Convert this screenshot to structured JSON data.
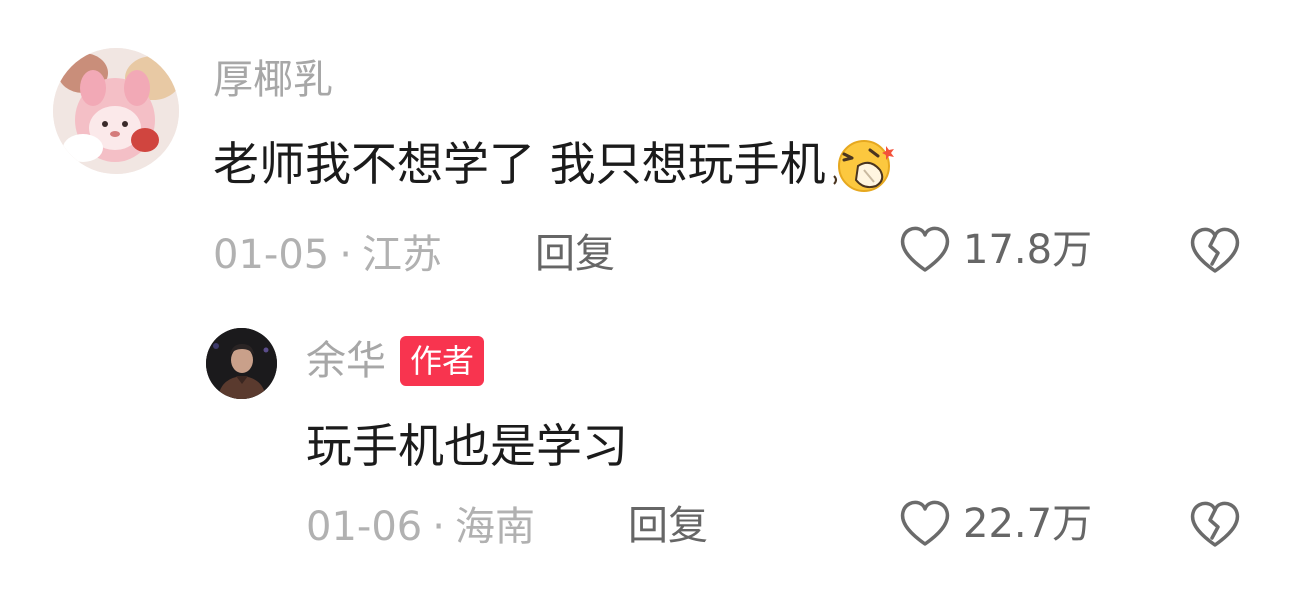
{
  "comments": [
    {
      "username": "厚椰乳",
      "text": "老师我不想学了 我只想玩手机",
      "emoji": "face-with-hand-over-mouth-emoji",
      "date": "01-05",
      "separator": "·",
      "location": "江苏",
      "reply_label": "回复",
      "like_count": "17.8万",
      "like_icon": "heart-icon",
      "dislike_icon": "broken-heart-icon"
    },
    {
      "username": "余华",
      "badge": "作者",
      "badge_color": "#f8344f",
      "text": "玩手机也是学习",
      "date": "01-06",
      "separator": "·",
      "location": "海南",
      "reply_label": "回复",
      "like_count": "22.7万",
      "like_icon": "heart-icon",
      "dislike_icon": "broken-heart-icon"
    }
  ]
}
